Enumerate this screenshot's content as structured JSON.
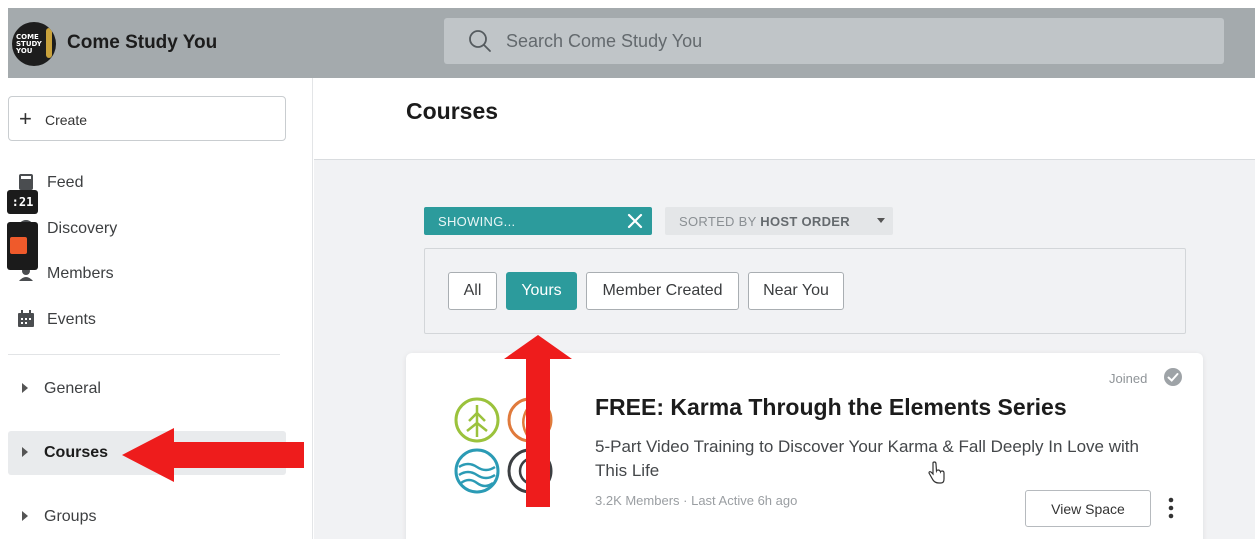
{
  "app": {
    "name": "Come Study You",
    "logo_text": "COME STUDY YOU"
  },
  "search": {
    "placeholder": "Search Come Study You",
    "icon": "search-icon"
  },
  "sidebar": {
    "create_label": "Create",
    "nav": [
      {
        "label": "Feed",
        "icon": "feed-icon"
      },
      {
        "label": "Discovery",
        "icon": "compass-icon"
      },
      {
        "label": "Members",
        "icon": "members-icon"
      },
      {
        "label": "Events",
        "icon": "calendar-icon"
      }
    ],
    "groups": [
      {
        "label": "General"
      },
      {
        "label": "Courses",
        "active": true
      },
      {
        "label": "Groups"
      }
    ]
  },
  "overlay": {
    "timer": ":21"
  },
  "main": {
    "title": "Courses",
    "showing_label": "SHOWING...",
    "sort": {
      "prefix": "SORTED BY",
      "value": "HOST ORDER"
    },
    "filters": [
      {
        "label": "All"
      },
      {
        "label": "Yours",
        "active": true
      },
      {
        "label": "Member Created"
      },
      {
        "label": "Near You"
      }
    ],
    "course": {
      "title": "FREE: Karma Through the Elements Series",
      "description": "5-Part Video Training to Discover Your Karma & Fall Deeply In Love with This Life",
      "meta": "3.2K Members · Last Active 6h ago",
      "joined_label": "Joined",
      "view_button": "View Space"
    }
  },
  "colors": {
    "topbar": "#a4aaad",
    "accent": "#2c9b9c",
    "arrow": "#ee1c1c"
  }
}
